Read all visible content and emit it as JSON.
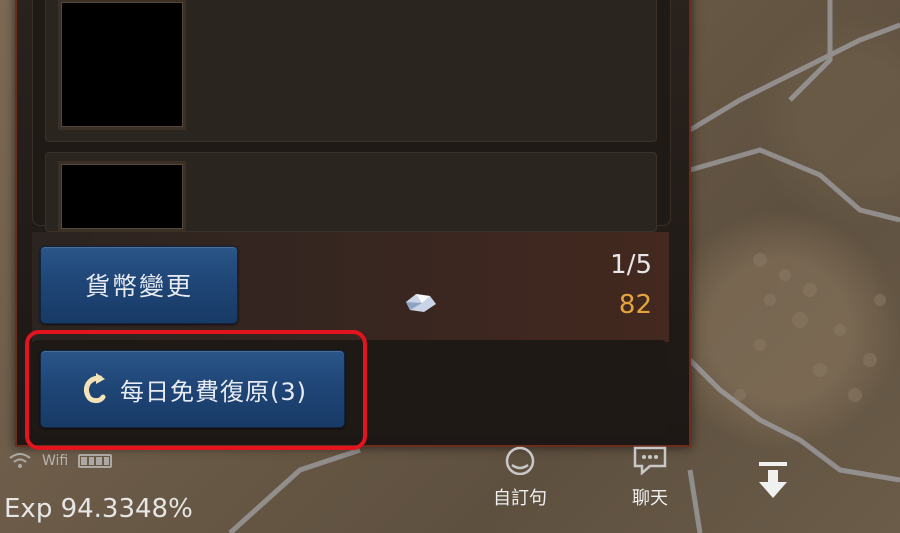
{
  "panel": {
    "currency_button": "貨幣變更",
    "ratio": "1/5",
    "amount": "82",
    "amount_color": "#e4a43e",
    "daily_recover_button": "每日免費復原(3)",
    "highlight_color": "#e3141e"
  },
  "hud": {
    "wifi_label": "Wifi",
    "exp": "Exp 94.3348%",
    "submit_label": "自訂句",
    "chat_label": "聊天"
  }
}
